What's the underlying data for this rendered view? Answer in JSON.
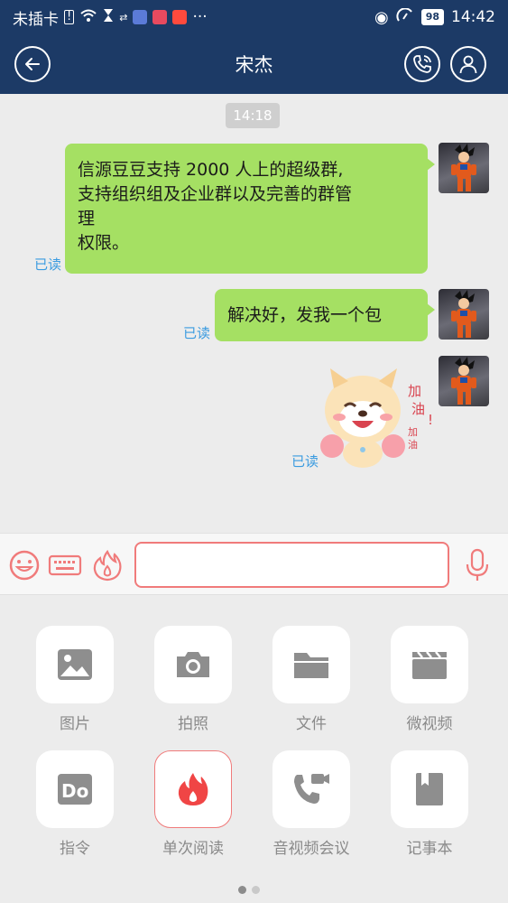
{
  "status_bar": {
    "carrier": "未插卡",
    "battery": "98",
    "time": "14:42",
    "more": "···"
  },
  "header": {
    "title": "宋杰",
    "back_icon": "back-arrow-icon",
    "call_icon": "phone-call-icon",
    "profile_icon": "user-profile-icon",
    "background": "#1c3a66"
  },
  "chat": {
    "timestamp": "14:18",
    "messages": [
      {
        "text": "信源豆豆支持 2000 人上的超级群,\n支持组织组及企业群以及完善的群管\n理\n权限。",
        "status": "已读"
      },
      {
        "text": "解决好，发我一个包",
        "status": "已读"
      },
      {
        "sticker": "dog-cheering-sticker",
        "sticker_text": "加油！ 加油",
        "status": "已读"
      }
    ],
    "bubble_color": "#a5e063",
    "read_color": "#3a9be0"
  },
  "input_bar": {
    "emoji_icon": "emoji-icon",
    "keyboard_icon": "keyboard-icon",
    "burn_icon": "fire-icon",
    "mic_icon": "microphone-icon",
    "placeholder": "",
    "accent": "#f07b7b"
  },
  "panel": {
    "tools": [
      {
        "label": "图片",
        "icon": "image-icon"
      },
      {
        "label": "拍照",
        "icon": "camera-icon"
      },
      {
        "label": "文件",
        "icon": "folder-icon"
      },
      {
        "label": "微视频",
        "icon": "clapperboard-icon"
      },
      {
        "label": "指令",
        "icon": "do-command-icon"
      },
      {
        "label": "单次阅读",
        "icon": "fire-icon"
      },
      {
        "label": "音视频会议",
        "icon": "video-call-icon"
      },
      {
        "label": "记事本",
        "icon": "notebook-icon"
      }
    ],
    "page_indicator": {
      "pages": 2,
      "current": 1
    }
  }
}
